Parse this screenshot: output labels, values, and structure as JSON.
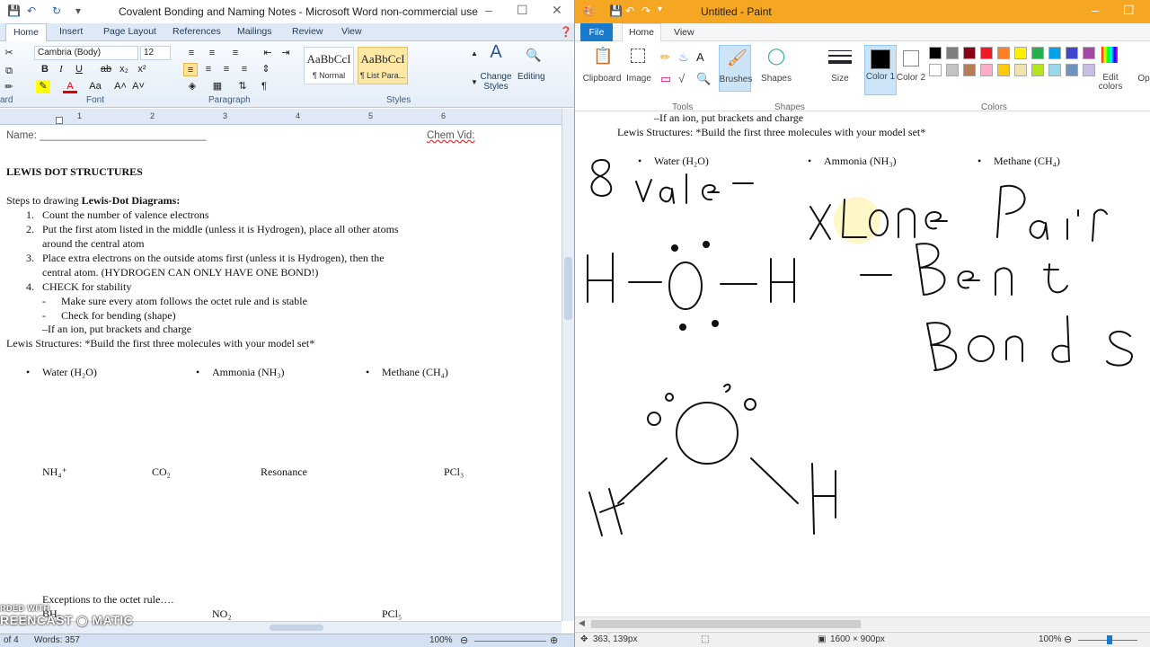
{
  "word": {
    "title": "Covalent Bonding and Naming Notes - Microsoft Word non-commercial use",
    "tabs": [
      "Home",
      "Insert",
      "Page Layout",
      "References",
      "Mailings",
      "Review",
      "View"
    ],
    "font_name": "Cambria (Body)",
    "font_size": "12",
    "groups": {
      "clipboard": "ard",
      "font": "Font",
      "paragraph": "Paragraph",
      "styles": "Styles",
      "editing": ""
    },
    "styles": [
      {
        "preview": "AaBbCcI",
        "name": "¶ Normal"
      },
      {
        "preview": "AaBbCcI",
        "name": "¶ List Para..."
      }
    ],
    "change_styles": "Change Styles",
    "editing": "Editing",
    "ruler_numbers": [
      "1",
      "2",
      "3",
      "4",
      "5",
      "6"
    ],
    "doc": {
      "name_label": "Name: _____________________________",
      "chem_vid": "Chem Vid:",
      "heading": "LEWIS DOT STRUCTURES",
      "steps_intro": "Steps to drawing ",
      "steps_bold": "Lewis-Dot Diagrams:",
      "steps": [
        {
          "num": "1.",
          "text": "Count the number of valence electrons"
        },
        {
          "num": "2.",
          "text": "Put the first atom listed in the middle (unless it is Hydrogen), place all other atoms"
        },
        {
          "num": "",
          "text": "around the central atom"
        },
        {
          "num": "3.",
          "text": "Place extra electrons on the outside atoms first (unless it is Hydrogen), then the"
        },
        {
          "num": "",
          "text": "central atom. (HYDROGEN CAN ONLY HAVE ONE BOND!)"
        },
        {
          "num": "4.",
          "text": "CHECK for stability"
        }
      ],
      "sub": [
        {
          "dash": "-",
          "text": "Make sure every atom follows the octet rule and is stable"
        },
        {
          "dash": "-",
          "text": "Check for bending (shape)"
        }
      ],
      "ion_note": "–If an ion, put brackets and charge",
      "lewis_line": "Lewis Structures: *Build the first three molecules with your model set*",
      "molecules": [
        "Water (H₂O)",
        "Ammonia (NH₃)",
        "Methane (CH₄)"
      ],
      "row2": [
        "NH₄⁺",
        "CO₂",
        "Resonance",
        "PCl₃"
      ],
      "exceptions": "Exceptions to the octet rule….",
      "row3": [
        "BH₃",
        "NO₂",
        "PCl₅"
      ]
    },
    "status": {
      "page": "of 4",
      "words": "Words: 357",
      "zoom": "100%"
    }
  },
  "watermark": "RDED WITH\nREENCAST ◉ MATIC",
  "paint": {
    "title": "Untitled - Paint",
    "tabs": {
      "file": "File",
      "home": "Home",
      "view": "View"
    },
    "tools": {
      "clipboard": "Clipboard",
      "image": "Image",
      "brushes": "Brushes",
      "shapes": "Shapes",
      "size": "Size",
      "color1": "Color 1",
      "color2": "Color 2",
      "edit_colors": "Edit colors",
      "open": "Op"
    },
    "groups": {
      "tools": "Tools",
      "shapes": "Shapes",
      "colors": "Colors"
    },
    "palette": [
      "#000000",
      "#7f7f7f",
      "#880015",
      "#ed1c24",
      "#ff7f27",
      "#fff200",
      "#22b14c",
      "#00a2e8",
      "#3f48cc",
      "#a349a4",
      "#ffffff",
      "#c3c3c3",
      "#b97a57",
      "#ffaec9",
      "#ffc90e",
      "#efe4b0",
      "#b5e61d",
      "#99d9ea",
      "#7092be",
      "#c8bfe7"
    ],
    "canvas_text": {
      "ion_note": "–If an ion, put brackets and charge",
      "lewis_line": "Lewis Structures: *Build the first three molecules with your model set*",
      "molecules": [
        "Water (H₂O)",
        "Ammonia (NH₃)",
        "Methane (CH₄)"
      ]
    },
    "status": {
      "cursor": "363, 139px",
      "size": "1600 × 900px",
      "zoom": "100%"
    }
  }
}
